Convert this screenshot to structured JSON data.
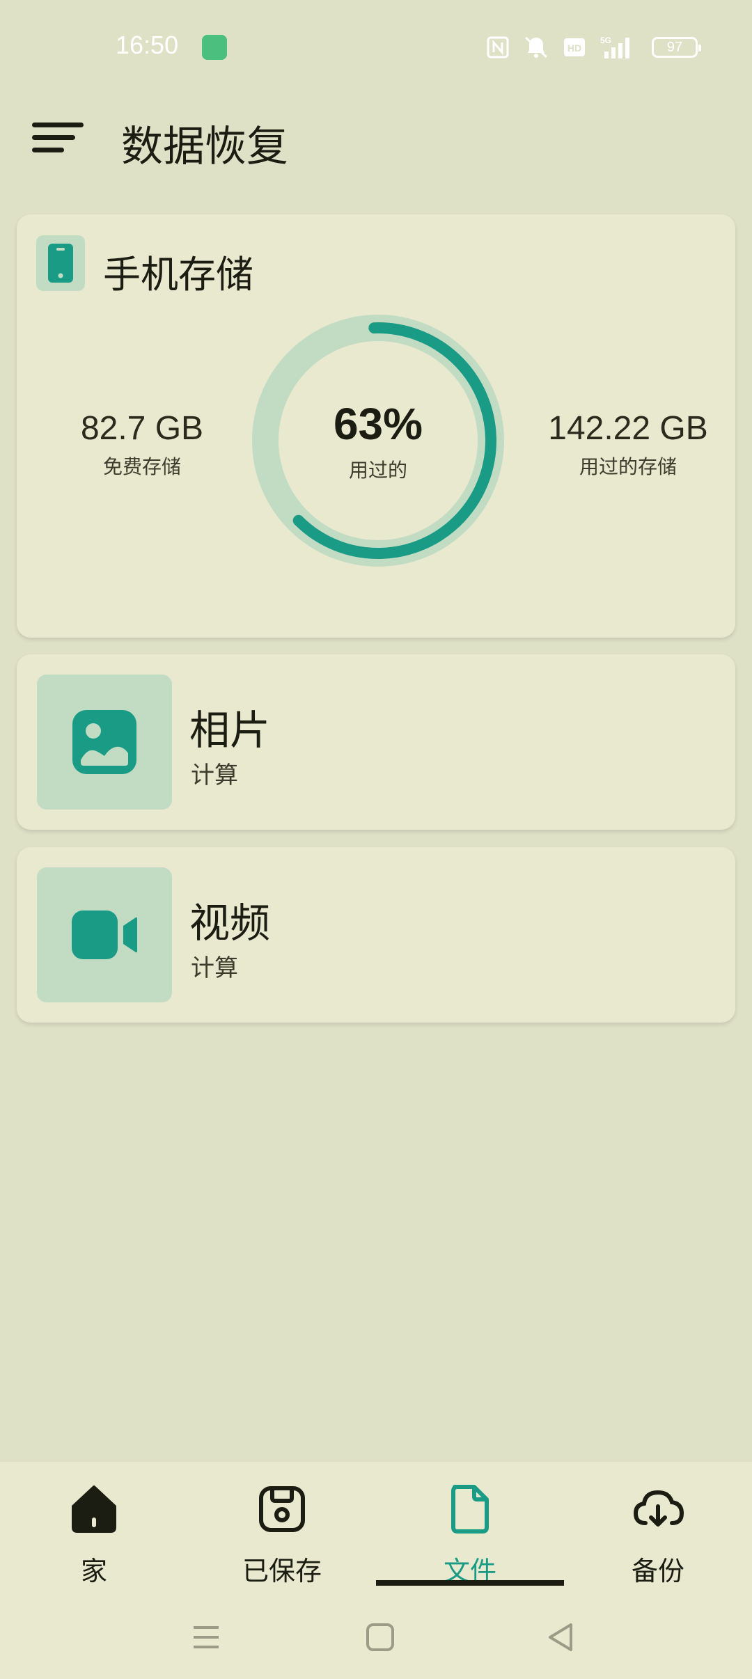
{
  "status_bar": {
    "time": "16:50",
    "battery": "97",
    "icons": [
      "nfc-icon",
      "mute-icon",
      "hd-icon",
      "signal-5g-icon",
      "battery-icon"
    ]
  },
  "header": {
    "title": "数据恢复",
    "menu_icon": "menu-icon"
  },
  "storage": {
    "title": "手机存储",
    "icon": "phone-icon",
    "free_value": "82.7 GB",
    "free_label": "免费存储",
    "used_percent_text": "63%",
    "used_fraction": 0.63,
    "used_label": "用过的",
    "used_value": "142.22 GB",
    "used_value_label": "用过的存储",
    "accent_color": "#1a9b86",
    "track_color": "#c2dcc4"
  },
  "items": [
    {
      "title": "相片",
      "subtitle": "计算",
      "icon": "image-icon"
    },
    {
      "title": "视频",
      "subtitle": "计算",
      "icon": "video-icon"
    }
  ],
  "bottom_nav": {
    "items": [
      {
        "label": "家",
        "icon": "home-icon",
        "active": false
      },
      {
        "label": "已保存",
        "icon": "saved-icon",
        "active": false
      },
      {
        "label": "文件",
        "icon": "file-icon",
        "active": true
      },
      {
        "label": "备份",
        "icon": "cloud-download-icon",
        "active": false
      }
    ],
    "active_color": "#1a9b86"
  },
  "system_nav": [
    "recents-button",
    "home-button",
    "back-button"
  ]
}
